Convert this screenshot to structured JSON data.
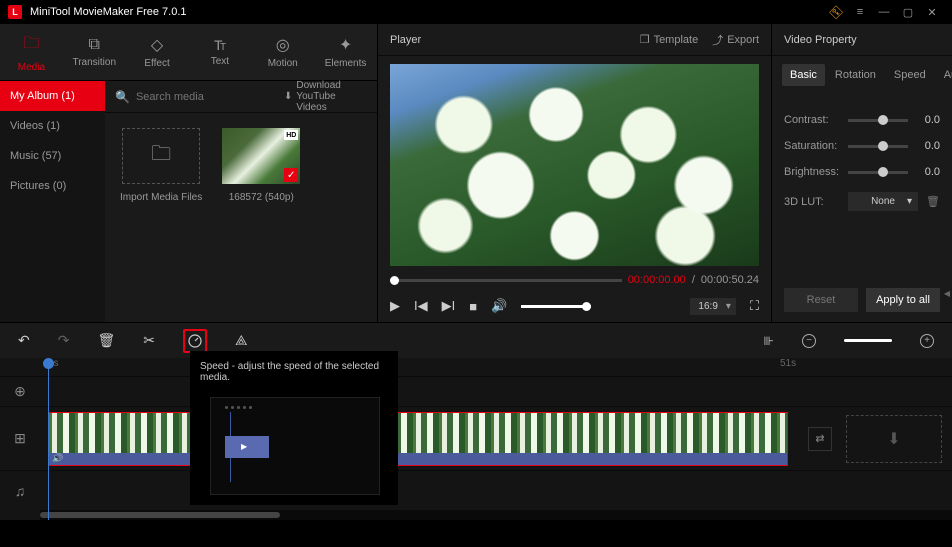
{
  "app": {
    "title": "MiniTool MovieMaker Free 7.0.1"
  },
  "tabs": [
    {
      "label": "Media",
      "icon": "folder",
      "active": true
    },
    {
      "label": "Transition",
      "icon": "transition"
    },
    {
      "label": "Effect",
      "icon": "effect"
    },
    {
      "label": "Text",
      "icon": "text"
    },
    {
      "label": "Motion",
      "icon": "motion"
    },
    {
      "label": "Elements",
      "icon": "elements"
    }
  ],
  "library": {
    "sidebar": [
      {
        "label": "My Album (1)",
        "active": true
      },
      {
        "label": "Videos (1)"
      },
      {
        "label": "Music (57)"
      },
      {
        "label": "Pictures (0)"
      }
    ],
    "search_placeholder": "Search media",
    "download_label": "Download YouTube Videos",
    "import_label": "Import Media Files",
    "clip_label": "168572 (540p)"
  },
  "player": {
    "title": "Player",
    "template_label": "Template",
    "export_label": "Export",
    "current_time": "00:00:00.00",
    "total_time": "00:00:50.24",
    "aspect": "16:9"
  },
  "props": {
    "title": "Video Property",
    "tabs": [
      {
        "label": "Basic",
        "active": true
      },
      {
        "label": "Rotation"
      },
      {
        "label": "Speed"
      },
      {
        "label": "Audio"
      }
    ],
    "contrast": {
      "label": "Contrast:",
      "value": "0.0",
      "pos": 50
    },
    "saturation": {
      "label": "Saturation:",
      "value": "0.0",
      "pos": 50
    },
    "brightness": {
      "label": "Brightness:",
      "value": "0.0",
      "pos": 50
    },
    "lut": {
      "label": "3D LUT:",
      "value": "None"
    },
    "reset": "Reset",
    "apply": "Apply to all"
  },
  "timeline": {
    "tooltip": "Speed - adjust the speed of the selected media.",
    "ruler_start": "0s",
    "ruler_end": "51s"
  }
}
